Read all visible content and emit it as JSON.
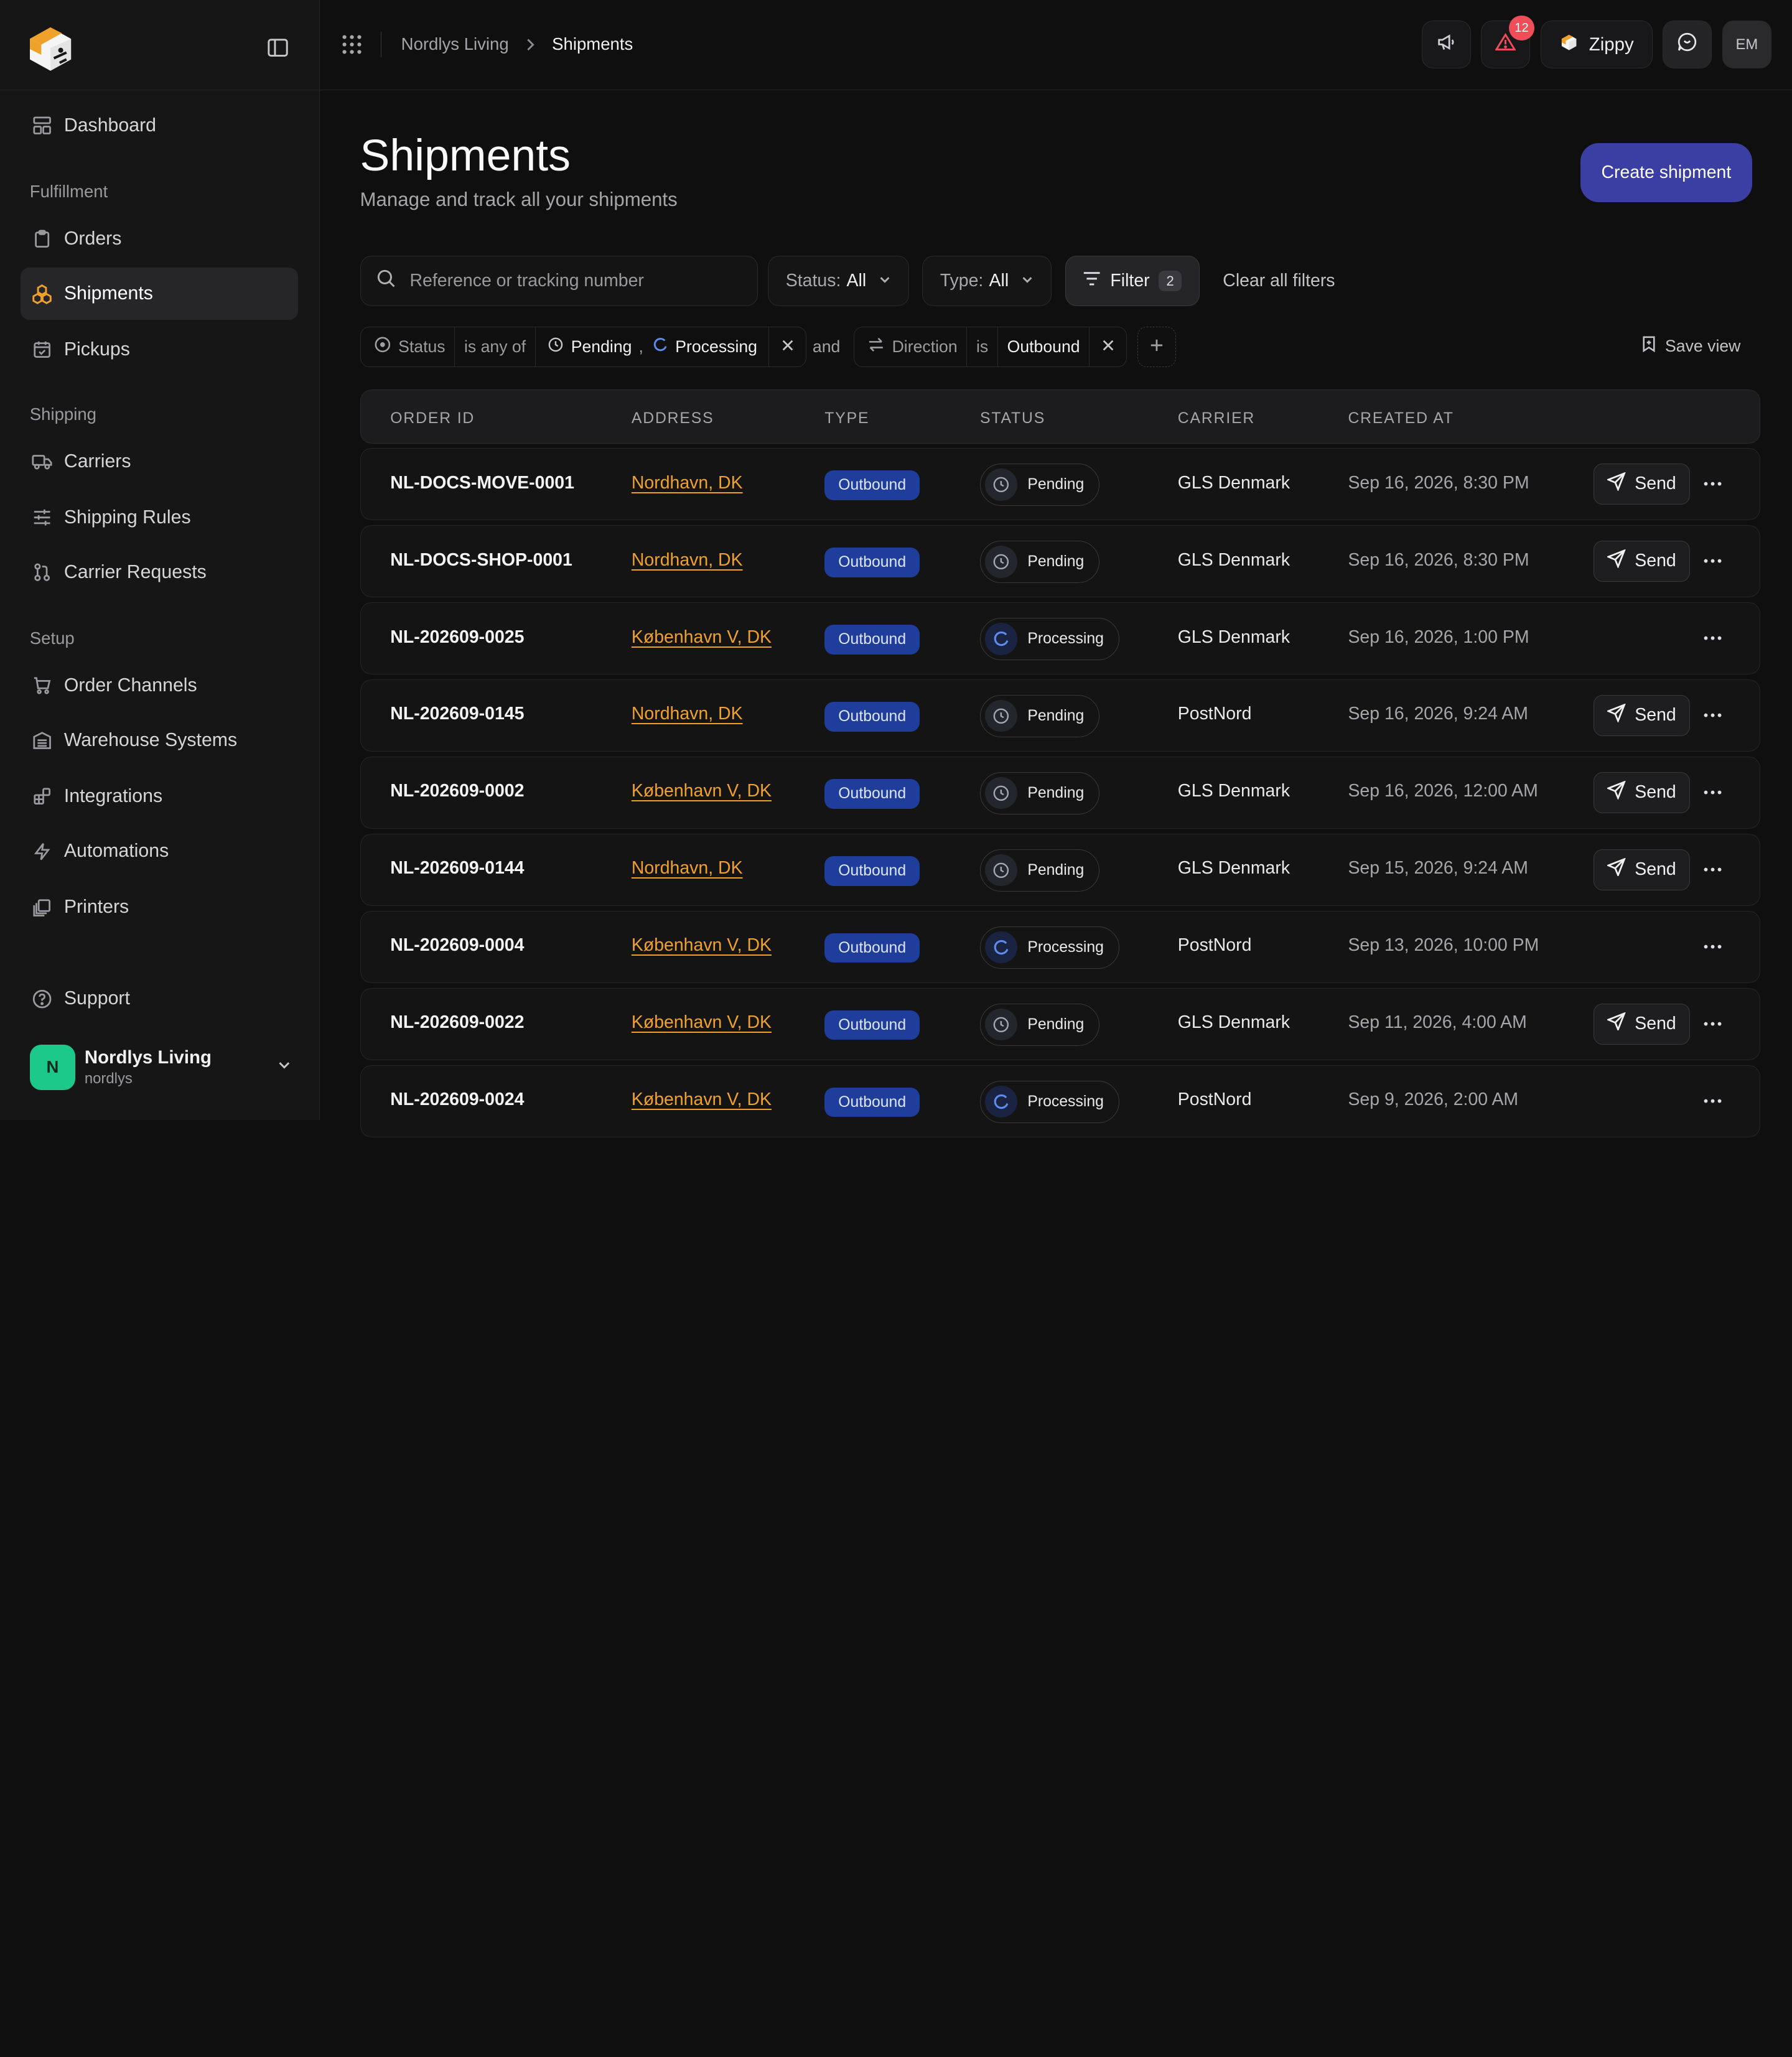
{
  "sidebar": {
    "logo_icon": "box-logo-icon",
    "items": {
      "dashboard": "Dashboard",
      "orders": "Orders",
      "shipments": "Shipments",
      "pickups": "Pickups",
      "carriers": "Carriers",
      "shipping_rules": "Shipping Rules",
      "carrier_requests": "Carrier Requests",
      "order_channels": "Order Channels",
      "warehouse_systems": "Warehouse Systems",
      "integrations": "Integrations",
      "automations": "Automations",
      "printers": "Printers",
      "support": "Support"
    },
    "sections": {
      "fulfillment": "Fulfillment",
      "shipping": "Shipping",
      "setup": "Setup"
    },
    "account": {
      "initial": "N",
      "name": "Nordlys Living",
      "handle": "nordlys"
    }
  },
  "topbar": {
    "breadcrumb": {
      "org": "Nordlys Living",
      "page": "Shipments"
    },
    "alerts_count": "12",
    "brand_button": "Zippy",
    "user_initials": "EM"
  },
  "page": {
    "title": "Shipments",
    "subtitle": "Manage and track all your shipments",
    "create_button": "Create shipment"
  },
  "filters": {
    "search_placeholder": "Reference or tracking number",
    "status": {
      "label": "Status:",
      "value": "All"
    },
    "type": {
      "label": "Type:",
      "value": "All"
    },
    "filter_button": "Filter",
    "filter_count": "2",
    "clear_all": "Clear all filters",
    "chips": {
      "status_field": "Status",
      "status_op": "is any of",
      "status_val1": "Pending",
      "status_sep": ",",
      "status_val2": "Processing",
      "joiner": "and",
      "direction_field": "Direction",
      "direction_op": "is",
      "direction_val": "Outbound"
    },
    "save_view": "Save view"
  },
  "table": {
    "headers": {
      "order_id": "ORDER ID",
      "address": "ADDRESS",
      "type": "TYPE",
      "status": "STATUS",
      "carrier": "CARRIER",
      "created_at": "CREATED AT"
    },
    "send_label": "Send",
    "rows": [
      {
        "order_id": "NL-DOCS-MOVE-0001",
        "address": "Nordhavn, DK",
        "type": "Outbound",
        "status": "Pending",
        "carrier": "GLS Denmark",
        "created": "Sep 16, 2026, 8:30 PM",
        "send": true
      },
      {
        "order_id": "NL-DOCS-SHOP-0001",
        "address": "Nordhavn, DK",
        "type": "Outbound",
        "status": "Pending",
        "carrier": "GLS Denmark",
        "created": "Sep 16, 2026, 8:30 PM",
        "send": true
      },
      {
        "order_id": "NL-202609-0025",
        "address": "København V, DK",
        "type": "Outbound",
        "status": "Processing",
        "carrier": "GLS Denmark",
        "created": "Sep 16, 2026, 1:00 PM",
        "send": false
      },
      {
        "order_id": "NL-202609-0145",
        "address": "Nordhavn, DK",
        "type": "Outbound",
        "status": "Pending",
        "carrier": "PostNord",
        "created": "Sep 16, 2026, 9:24 AM",
        "send": true
      },
      {
        "order_id": "NL-202609-0002",
        "address": "København V, DK",
        "type": "Outbound",
        "status": "Pending",
        "carrier": "GLS Denmark",
        "created": "Sep 16, 2026, 12:00 AM",
        "send": true
      },
      {
        "order_id": "NL-202609-0144",
        "address": "Nordhavn, DK",
        "type": "Outbound",
        "status": "Pending",
        "carrier": "GLS Denmark",
        "created": "Sep 15, 2026, 9:24 AM",
        "send": true
      },
      {
        "order_id": "NL-202609-0004",
        "address": "København V, DK",
        "type": "Outbound",
        "status": "Processing",
        "carrier": "PostNord",
        "created": "Sep 13, 2026, 10:00 PM",
        "send": false
      },
      {
        "order_id": "NL-202609-0022",
        "address": "København V, DK",
        "type": "Outbound",
        "status": "Pending",
        "carrier": "GLS Denmark",
        "created": "Sep 11, 2026, 4:00 AM",
        "send": true
      },
      {
        "order_id": "NL-202609-0024",
        "address": "København V, DK",
        "type": "Outbound",
        "status": "Processing",
        "carrier": "PostNord",
        "created": "Sep 9, 2026, 2:00 AM",
        "send": false
      }
    ]
  },
  "colors": {
    "accent": "#f0a12a",
    "primary_button": "#3b3fa3",
    "outbound_badge": "#1f3d9a",
    "alert_badge": "#ef4d58",
    "account_avatar": "#1cc98a"
  }
}
